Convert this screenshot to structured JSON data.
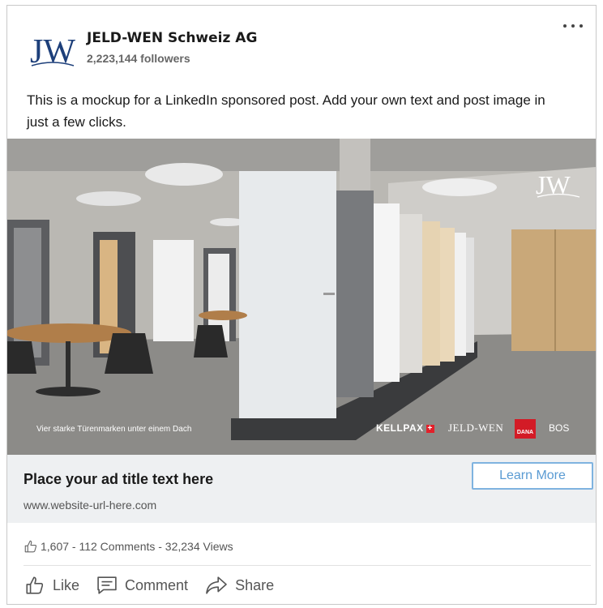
{
  "post": {
    "company_name": "JELD-WEN Schweiz AG",
    "followers": "2,223,144 followers",
    "text": "This is a mockup for a LinkedIn sponsored post. Add your own text and post image in just a few clicks.",
    "logo_text": "JW",
    "logo_color": "#1d3f7a"
  },
  "image": {
    "caption": "Vier starke Türenmarken unter einem Dach",
    "logo_text": "JW",
    "brands": {
      "kellpax": "KELLPAX",
      "kellpax_plus": "+",
      "jeldwen": "JELD-WEN",
      "dana": "DANA",
      "bos": "BOS"
    }
  },
  "ad": {
    "title": "Place your ad title text here",
    "url": "www.website-url-here.com",
    "cta_label": "Learn More",
    "cta_color": "#5a9bd3"
  },
  "stats": {
    "text": "1,607 - 112 Comments - 32,234 Views"
  },
  "actions": {
    "like": "Like",
    "comment": "Comment",
    "share": "Share"
  }
}
